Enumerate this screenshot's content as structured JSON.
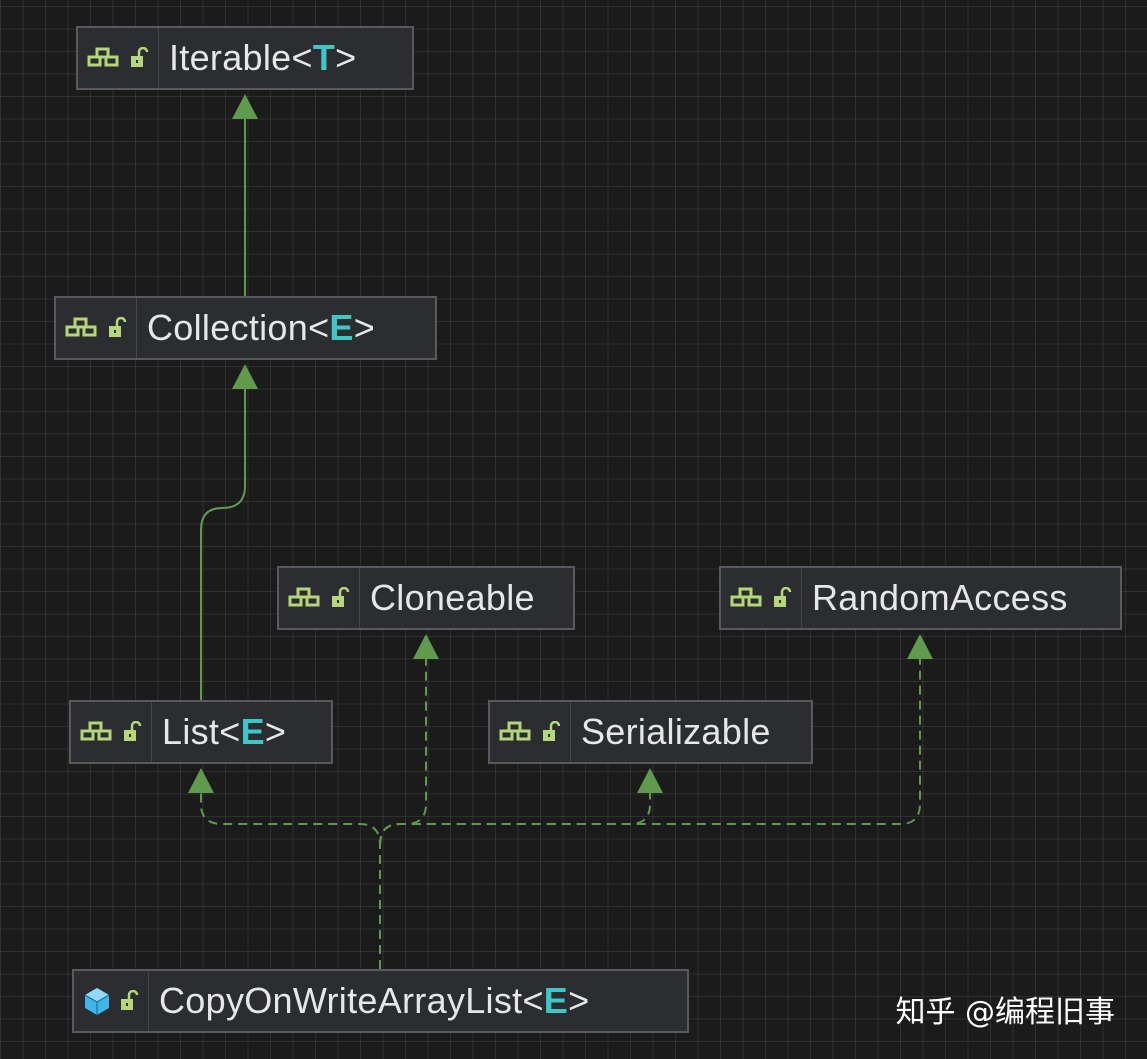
{
  "colors": {
    "background": "#1b1b1b",
    "node_fill": "#2b2d30",
    "node_border": "#585a5e",
    "edge": "#5f9a4d",
    "type_param": "#3dc7c7",
    "interface_icon": "#b5d77a",
    "class_icon": "#3fb6ea"
  },
  "nodes": {
    "iterable": {
      "name": "Iterable",
      "type_param": "T",
      "icon": "interface-icon"
    },
    "collection": {
      "name": "Collection",
      "type_param": "E",
      "icon": "interface-icon"
    },
    "cloneable": {
      "name": "Cloneable",
      "icon": "interface-icon"
    },
    "random_access": {
      "name": "RandomAccess",
      "icon": "interface-icon"
    },
    "list": {
      "name": "List",
      "type_param": "E",
      "icon": "interface-icon"
    },
    "serializable": {
      "name": "Serializable",
      "icon": "interface-icon"
    },
    "copy_on_write": {
      "name": "CopyOnWriteArrayList",
      "type_param": "E",
      "icon": "class-icon"
    }
  },
  "edges": [
    {
      "from": "Collection",
      "to": "Iterable",
      "kind": "extends"
    },
    {
      "from": "List",
      "to": "Collection",
      "kind": "extends"
    },
    {
      "from": "CopyOnWriteArrayList",
      "to": "List",
      "kind": "implements"
    },
    {
      "from": "CopyOnWriteArrayList",
      "to": "Cloneable",
      "kind": "implements"
    },
    {
      "from": "CopyOnWriteArrayList",
      "to": "Serializable",
      "kind": "implements"
    },
    {
      "from": "CopyOnWriteArrayList",
      "to": "RandomAccess",
      "kind": "implements"
    }
  ],
  "watermark": "知乎 @编程旧事"
}
